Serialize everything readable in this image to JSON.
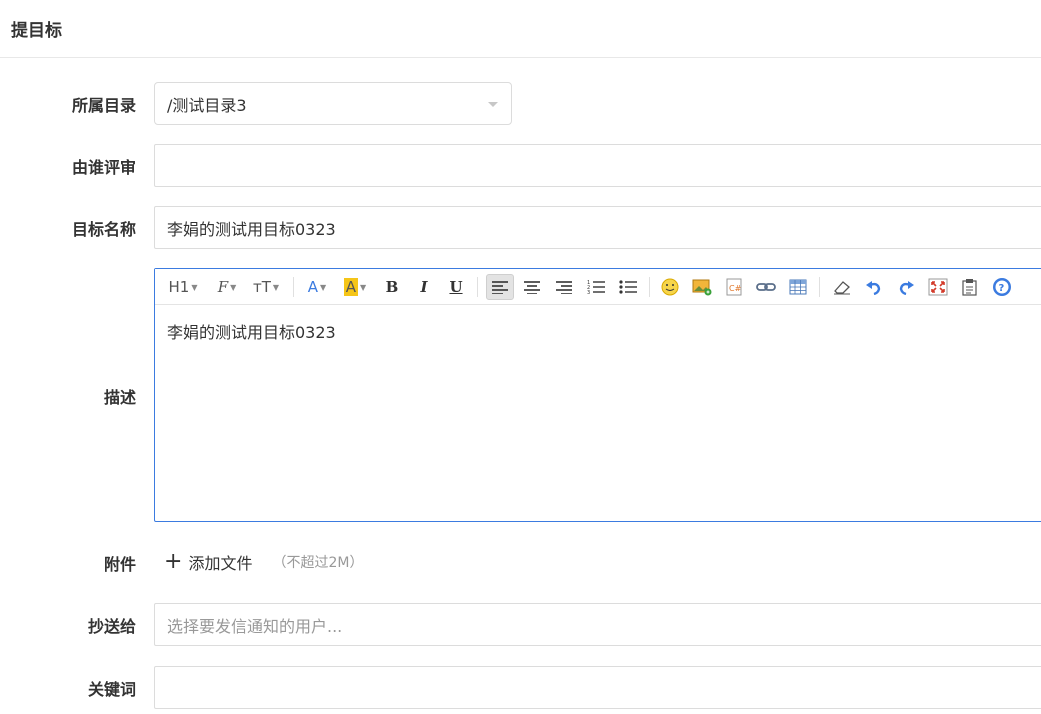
{
  "page": {
    "title": "提目标"
  },
  "form": {
    "directory": {
      "label": "所属目录",
      "value": "/测试目录3"
    },
    "reviewer": {
      "label": "由谁评审",
      "value": ""
    },
    "name": {
      "label": "目标名称",
      "value": "李娟的测试用目标0323"
    },
    "description": {
      "label": "描述",
      "content": "李娟的测试用目标0323"
    },
    "attachment": {
      "label": "附件",
      "add_label": "添加文件",
      "hint": "（不超过2M）"
    },
    "cc": {
      "label": "抄送给",
      "placeholder": "选择要发信通知的用户..."
    },
    "keywords": {
      "label": "关键词",
      "value": ""
    }
  },
  "toolbar": {
    "heading": "H1",
    "font_family": "F",
    "font_size": "тT",
    "font_color": "A",
    "highlight": "A",
    "bold": "B",
    "italic": "I",
    "underline": "U",
    "highlight_color": "#f5c518",
    "font_color_hex": "#3b7be0"
  }
}
